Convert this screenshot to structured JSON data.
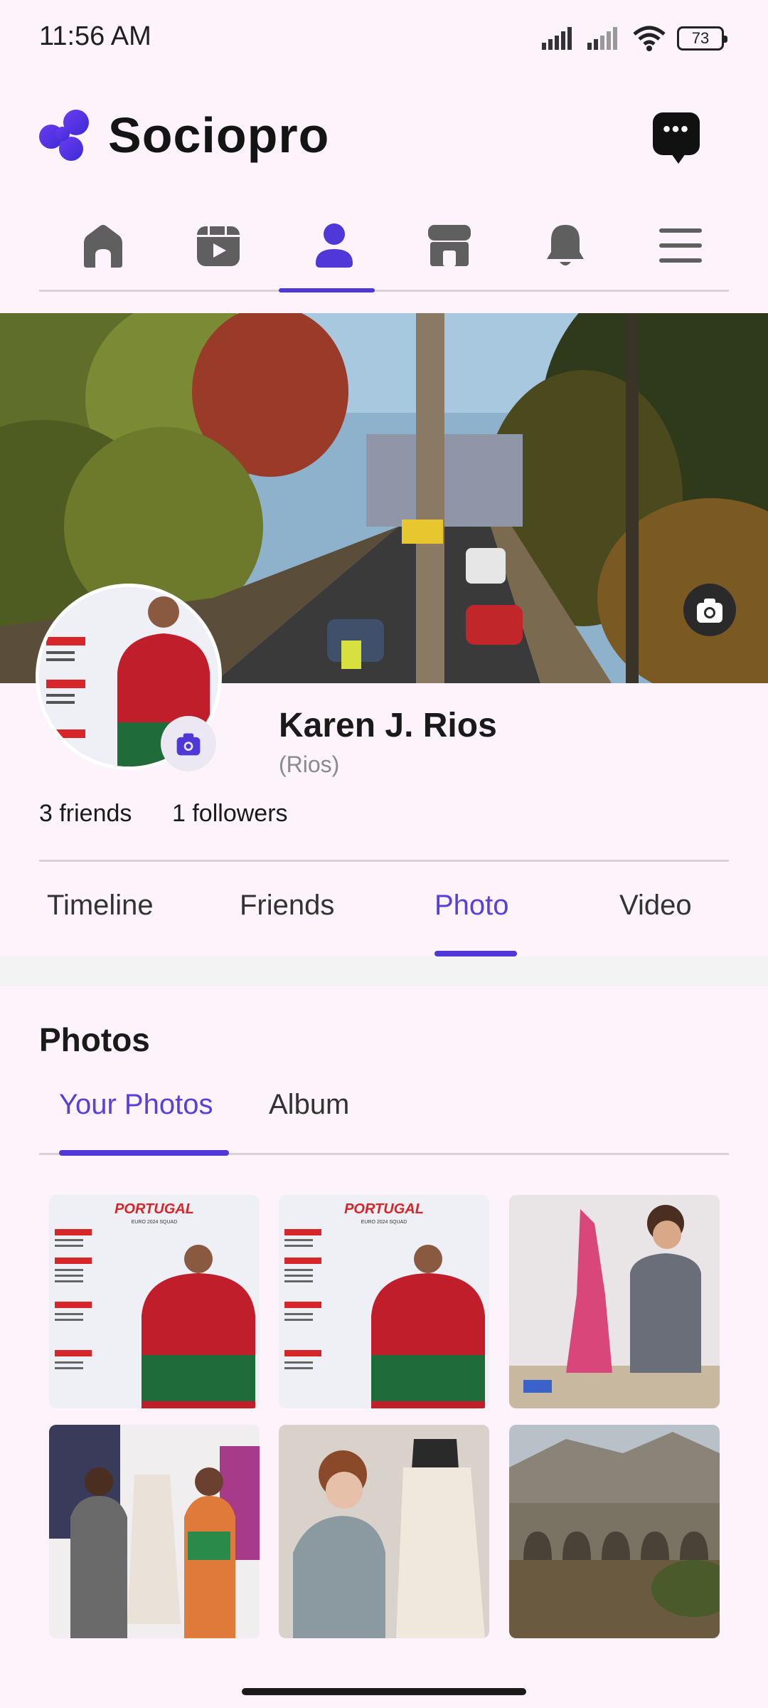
{
  "status_bar": {
    "time": "11:56 AM",
    "battery": "73"
  },
  "app": {
    "name": "Sociopro"
  },
  "icons": {
    "logo": "sociopro-logo-icon",
    "chat": "chat-bubble-icon",
    "nav": [
      "home-icon",
      "reels-icon",
      "profile-icon",
      "marketplace-icon",
      "bell-icon",
      "menu-icon"
    ],
    "cover_camera": "camera-icon",
    "avatar_camera": "camera-icon"
  },
  "colors": {
    "accent": "#4f37d8",
    "text": "#1c1b1f",
    "muted": "#8a8a8a",
    "background": "#fcf3fb"
  },
  "profile": {
    "name": "Karen J. Rios",
    "handle": "(Rios)",
    "friends": "3 friends",
    "followers": "1 followers"
  },
  "profile_tabs": [
    "Timeline",
    "Friends",
    "Photo",
    "Video"
  ],
  "active_profile_tab": "Photo",
  "photos_section": {
    "heading": "Photos",
    "tabs": [
      "Your Photos",
      "Album"
    ],
    "active_tab": "Your Photos"
  },
  "photos": [
    {
      "title": "PORTUGAL",
      "subtitle": "EURO 2024 SQUAD"
    },
    {
      "title": "PORTUGAL",
      "subtitle": "EURO 2024 SQUAD"
    },
    {
      "title": ""
    },
    {
      "title": ""
    },
    {
      "title": ""
    },
    {
      "title": ""
    }
  ]
}
